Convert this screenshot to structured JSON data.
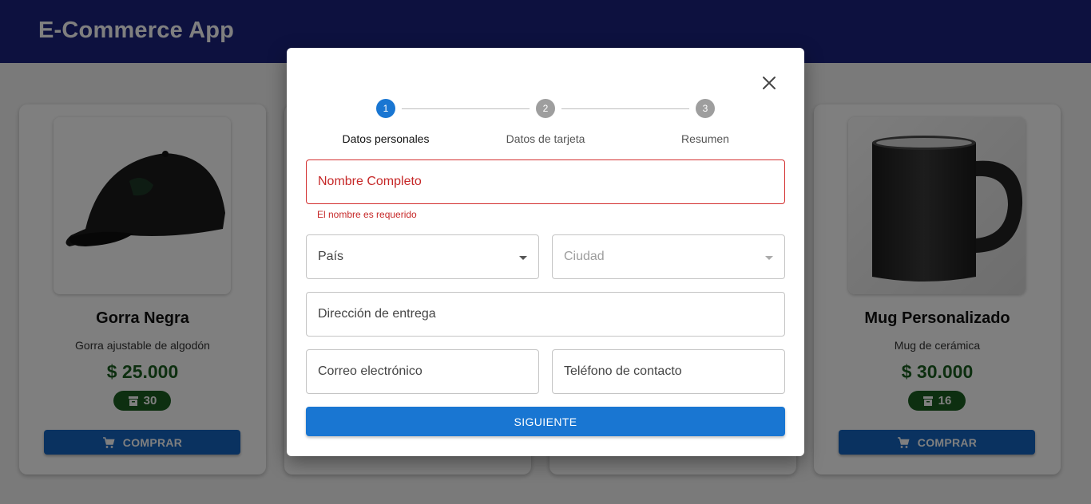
{
  "app": {
    "title": "E-Commerce App"
  },
  "products": [
    {
      "name": "Gorra Negra",
      "description": "Gorra ajustable de algodón",
      "price": "$ 25.000",
      "stock": "30",
      "buy_label": "COMPRAR"
    },
    {
      "name": "Mug Personalizado",
      "description": "Mug de cerámica",
      "price": "$ 30.000",
      "stock": "16",
      "buy_label": "COMPRAR"
    }
  ],
  "colors": {
    "appbar": "#1a237e",
    "primary": "#1976d2",
    "price": "#1b5e20",
    "error": "#d32f2f"
  },
  "icons": {
    "close": "close-icon",
    "cart": "cart-icon",
    "stock": "inventory-icon",
    "dropdown": "caret-down-icon"
  },
  "modal": {
    "steps": [
      {
        "number": "1",
        "label": "Datos personales",
        "active": true
      },
      {
        "number": "2",
        "label": "Datos de tarjeta",
        "active": false
      },
      {
        "number": "3",
        "label": "Resumen",
        "active": false
      }
    ],
    "fields": {
      "full_name": {
        "label": "Nombre Completo",
        "error": "El nombre es requerido"
      },
      "country": {
        "label": "País"
      },
      "city": {
        "label": "Ciudad",
        "disabled": true
      },
      "address": {
        "label": "Dirección de entrega"
      },
      "email": {
        "label": "Correo electrónico"
      },
      "phone": {
        "label": "Teléfono de contacto"
      }
    },
    "next_label": "SIGUIENTE"
  }
}
